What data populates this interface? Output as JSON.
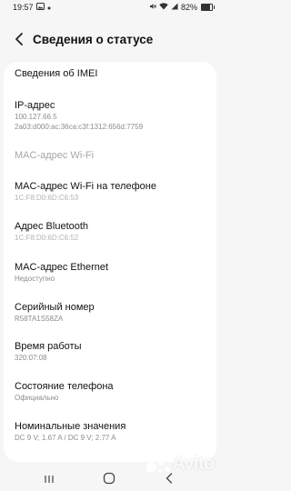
{
  "status_bar": {
    "time": "19:57",
    "battery_percent": "82%",
    "battery_level": 0.82
  },
  "header": {
    "title": "Сведения о статусе",
    "back_icon": "chevron-left-icon"
  },
  "items": [
    {
      "title": "Сведения об IMEI",
      "lines": []
    },
    {
      "title": "IP-адрес",
      "lines": [
        "100.127.66.5",
        "2a03:d000:ac:36ca:c3f:1312:656d:7759"
      ]
    },
    {
      "title": "MAC-адрес Wi-Fi",
      "lines": []
    },
    {
      "title": "MAC-адрес Wi-Fi на телефоне",
      "lines": [
        "1C:F8:D0:6D:C6:53"
      ]
    },
    {
      "title": "Адрес Bluetooth",
      "lines": [
        "1C:F8:D0:6D:C6:52"
      ]
    },
    {
      "title": "MAC-адрес Ethernet",
      "lines": [
        "Недоступно"
      ]
    },
    {
      "title": "Серийный номер",
      "lines": [
        "R58TA1S58ZA"
      ]
    },
    {
      "title": "Время работы",
      "lines": [
        "320:07:08"
      ]
    },
    {
      "title": "Состояние телефона",
      "lines": [
        "Официально"
      ]
    },
    {
      "title": "Номинальные значения",
      "lines": [
        "DC 9 V; 1.67 A / DC 9 V; 2.77 A"
      ]
    }
  ],
  "nav_bar": {
    "recents_icon": "recents-icon",
    "home_icon": "home-icon",
    "back_icon": "back-icon"
  },
  "watermark": {
    "text": "Avito"
  }
}
